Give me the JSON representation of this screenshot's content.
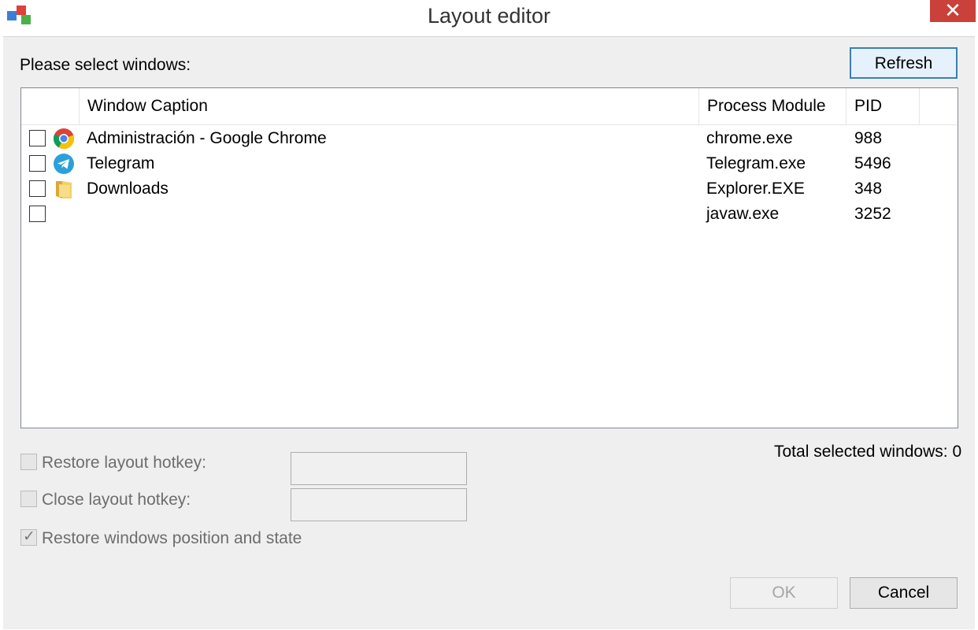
{
  "window": {
    "title": "Layout editor",
    "close_glyph": "✕"
  },
  "prompt": "Please select windows:",
  "refresh_label": "Refresh",
  "columns": [
    "Window Caption",
    "Process Module",
    "PID"
  ],
  "rows": [
    {
      "caption": "Administración - Google Chrome",
      "module": "chrome.exe",
      "pid": "988",
      "icon": "chrome-icon",
      "checked": false
    },
    {
      "caption": "Telegram",
      "module": "Telegram.exe",
      "pid": "5496",
      "icon": "telegram-icon",
      "checked": false
    },
    {
      "caption": "Downloads",
      "module": "Explorer.EXE",
      "pid": "348",
      "icon": "folder-icon",
      "checked": false
    },
    {
      "caption": "",
      "module": "javaw.exe",
      "pid": "3252",
      "icon": "",
      "checked": false
    }
  ],
  "total_selected": "Total selected windows: 0",
  "options": {
    "restore_hotkey_label": "Restore layout hotkey:",
    "close_hotkey_label": "Close layout hotkey:",
    "restore_state_label": "Restore windows position and state",
    "restore_state_checked": true,
    "restore_hotkey_value": "",
    "close_hotkey_value": ""
  },
  "buttons": {
    "ok": "OK",
    "cancel": "Cancel"
  },
  "colors": {
    "close": "#c9413a",
    "accent": "#3c7fb1"
  }
}
